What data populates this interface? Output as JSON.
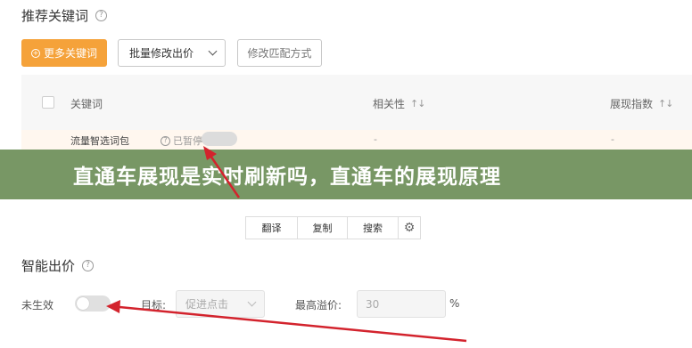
{
  "recommend": {
    "title": "推荐关键词",
    "more_keywords_btn": "更多关键词",
    "batch_bid_label": "批量修改出价",
    "match_mode_btn": "修改匹配方式",
    "columns": {
      "keyword": "关键词",
      "relevance": "相关性",
      "impression_index": "展现指数"
    },
    "row": {
      "label": "流量智选词包",
      "status": "已暂停",
      "relevance": "-",
      "impression_index": "-"
    }
  },
  "banner": {
    "text": "直通车展现是实时刷新吗，直通车的展现原理"
  },
  "toolbar": {
    "translate": "翻译",
    "copy": "复制",
    "search": "搜索"
  },
  "smart_bid": {
    "title": "智能出价",
    "status_label": "未生效",
    "target_label": "目标:",
    "target_value": "促进点击",
    "max_premium_label": "最高溢价:",
    "max_premium_placeholder": "30",
    "percent_sign": "%"
  },
  "colors": {
    "accent": "#f5a23a",
    "banner_bg": "#6c8e58",
    "arrow": "#d3232d"
  },
  "icons": {
    "help": "question-circle-icon",
    "plus": "plus-circle-icon",
    "sort": "sort-icon",
    "gear": "gear-icon"
  }
}
